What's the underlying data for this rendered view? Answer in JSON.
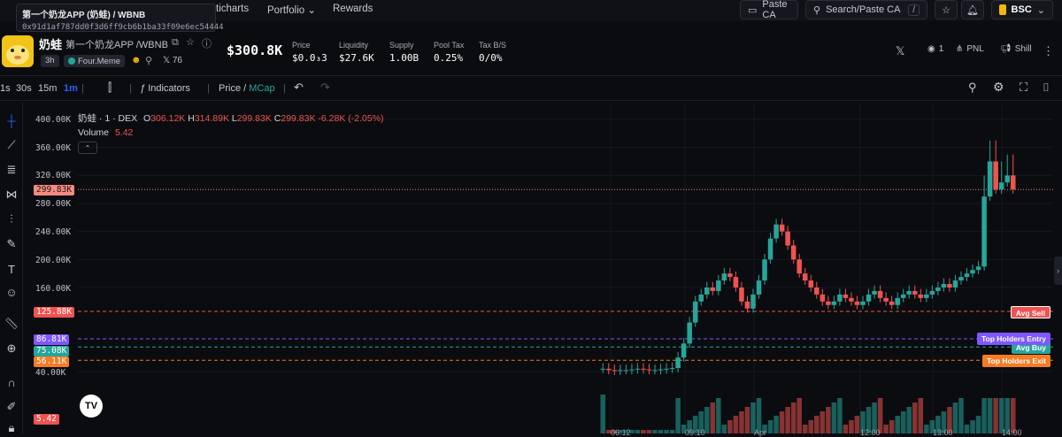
{
  "nav": {
    "links": [
      "ticharts",
      "Portfolio",
      "Rewards"
    ],
    "paste_ca": "Paste CA",
    "search_placeholder": "Search/Paste CA",
    "search_kbd": "/",
    "chain": "BSC"
  },
  "tooltip": {
    "title": "第一个奶龙APP (奶蛙) / WBNB",
    "address": "0x91d1af787dd0f3d6ff9cb6b1ba33f09e6ec54444"
  },
  "token": {
    "name": "奶蛙",
    "pair": "第一个奶龙APP /WBNB",
    "age": "3h",
    "launchpad": "Four.Meme",
    "x_followers": "76",
    "market_cap": "$300.8K",
    "stats": [
      {
        "label": "Price",
        "value": "$0.0₃3"
      },
      {
        "label": "Liquidity",
        "value": "$27.6K"
      },
      {
        "label": "Supply",
        "value": "1.00B"
      },
      {
        "label": "Pool Tax",
        "value": "0.25%"
      },
      {
        "label": "Tax B/S",
        "value": "0/0%"
      }
    ],
    "watchers": "1",
    "pnl_label": "PNL",
    "shill_label": "Shill"
  },
  "toolbar": {
    "timeframes": [
      "1s",
      "30s",
      "15m",
      "1m"
    ],
    "active_timeframe": "1m",
    "indicators": "Indicators",
    "price_label": "Price",
    "mcap_label": "MCap"
  },
  "chart_data": {
    "type": "candlestick",
    "legend": {
      "symbol": "奶蛙 · 1 · DEX",
      "open": "306.12K",
      "high": "314.89K",
      "low": "299.83K",
      "close": "299.83K",
      "change": "-6.28K (-2.05%)",
      "volume_label": "Volume",
      "volume_value": "5.42"
    },
    "ylim": [
      0,
      420000
    ],
    "y_ticks": [
      "400.00K",
      "360.00K",
      "320.00K",
      "280.00K",
      "240.00K",
      "200.00K",
      "160.00K",
      "40.00K"
    ],
    "x_ticks": [
      "06:12",
      "09:10",
      "Apr",
      "12:00",
      "13:00",
      "14:00"
    ],
    "current_price": "299.83K",
    "levels": [
      {
        "label": "Avg Sell",
        "value": "125.88K",
        "color": "#ef5350"
      },
      {
        "label": "Top Holders Entry",
        "value": "86.81K",
        "color": "#7e57ff"
      },
      {
        "label": "Avg Buy",
        "value": "75.08K",
        "color": "#26a69a"
      },
      {
        "label": "Top Holders Exit",
        "value": "56.11K",
        "color": "#f57c22"
      }
    ],
    "volume_badge": "5.42",
    "series": [
      {
        "name": "price_close_k",
        "values": [
          44,
          42,
          41,
          42,
          42,
          43,
          44,
          43,
          42,
          42,
          43,
          44,
          45,
          60,
          80,
          110,
          140,
          150,
          160,
          155,
          170,
          180,
          175,
          160,
          140,
          130,
          150,
          170,
          200,
          230,
          250,
          240,
          220,
          200,
          180,
          170,
          160,
          150,
          140,
          135,
          140,
          150,
          145,
          140,
          135,
          140,
          150,
          155,
          145,
          140,
          135,
          145,
          150,
          155,
          150,
          145,
          150,
          155,
          160,
          165,
          160,
          170,
          175,
          180,
          185,
          190,
          290,
          340,
          300,
          310,
          320,
          300
        ]
      }
    ]
  },
  "colors": {
    "up": "#26a69a",
    "down": "#ef5350",
    "current": "#f28b82"
  }
}
